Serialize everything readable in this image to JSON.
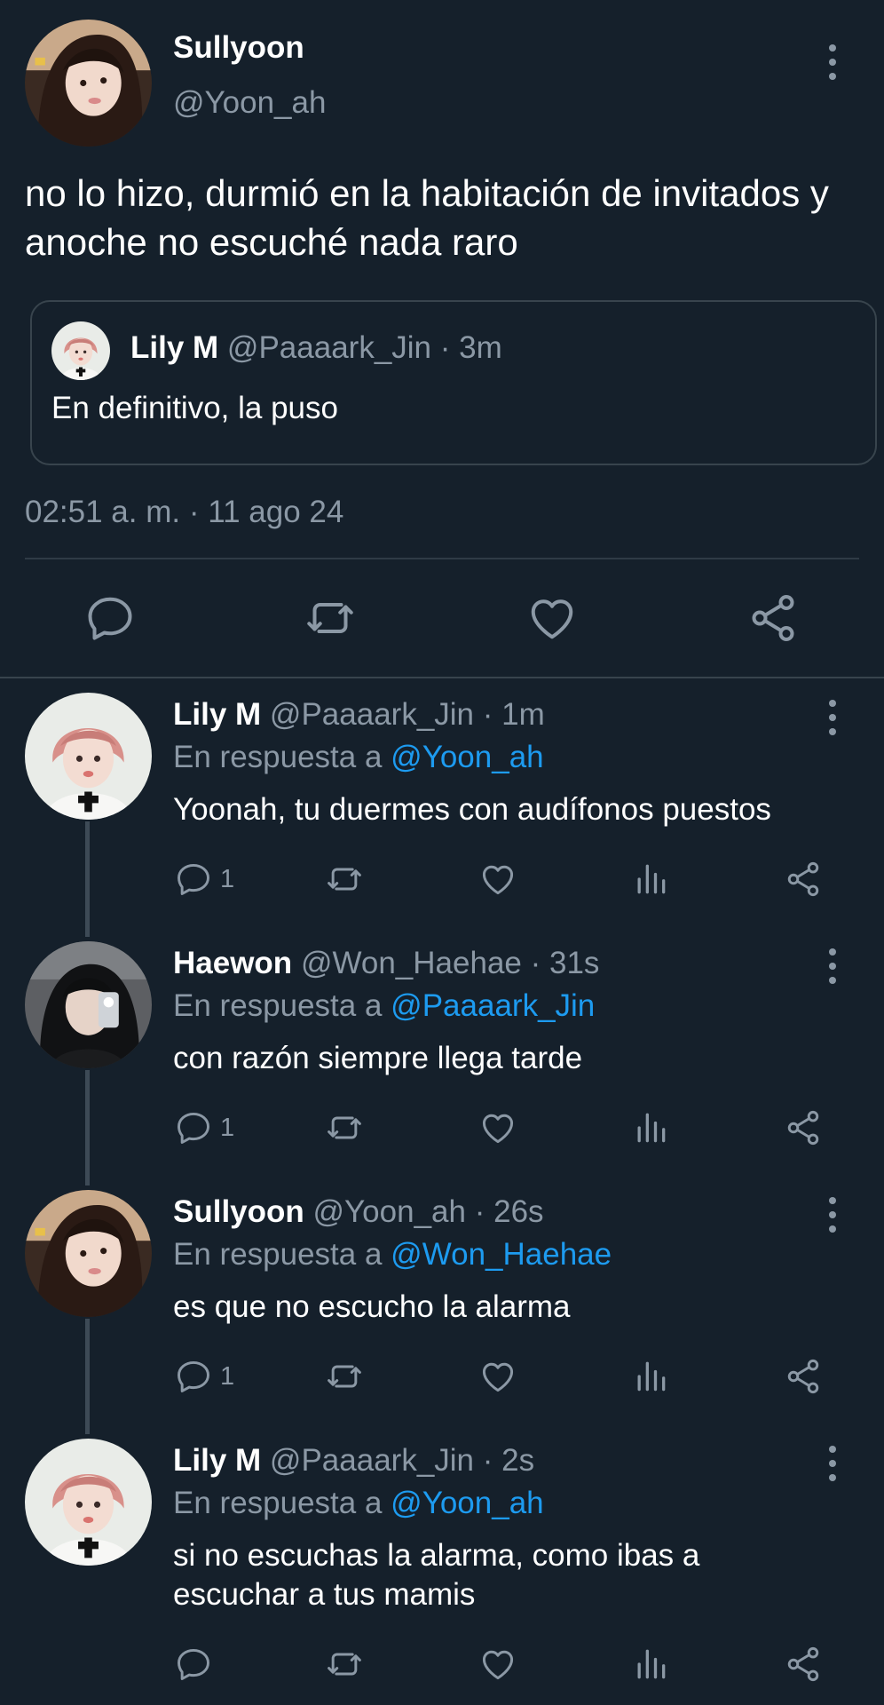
{
  "main_tweet": {
    "name": "Sullyoon",
    "handle": "@Yoon_ah",
    "text": "no lo hizo, durmió en la habitación de invitados y anoche no escuché nada raro",
    "quote": {
      "name": "Lily M",
      "handle": "@Paaaark_Jin",
      "time": "· 3m",
      "text": "En definitivo, la puso"
    },
    "timestamp": "02:51 a. m. · 11 ago 24"
  },
  "replies": [
    {
      "name": "Lily M",
      "handle": "@Paaaark_Jin",
      "time": "· 1m",
      "reply_prefix": "En respuesta a",
      "reply_to": "@Yoon_ah",
      "text": "Yoonah, tu duermes con audífonos puestos",
      "reply_count": "1"
    },
    {
      "name": "Haewon",
      "handle": "@Won_Haehae",
      "time": "· 31s",
      "reply_prefix": "En respuesta a",
      "reply_to": "@Paaaark_Jin",
      "text": "con razón siempre llega tarde",
      "reply_count": "1"
    },
    {
      "name": "Sullyoon",
      "handle": "@Yoon_ah",
      "time": "· 26s",
      "reply_prefix": "En respuesta a",
      "reply_to": "@Won_Haehae",
      "text": "es que no escucho la alarma",
      "reply_count": "1"
    },
    {
      "name": "Lily M",
      "handle": "@Paaaark_Jin",
      "time": "· 2s",
      "reply_prefix": "En respuesta a",
      "reply_to": "@Yoon_ah",
      "text": "si no escuchas la alarma, como ibas a escuchar a tus mamis",
      "reply_count": ""
    }
  ],
  "icons": {
    "reply": "reply-icon",
    "retweet": "retweet-icon",
    "like": "heart-icon",
    "views": "analytics-icon",
    "share": "share-icon",
    "more": "more-vertical-icon"
  },
  "colors": {
    "background": "#15202b",
    "text": "#ffffff",
    "secondary": "#8b98a5",
    "link": "#1d9bf0",
    "border": "#38444d"
  }
}
